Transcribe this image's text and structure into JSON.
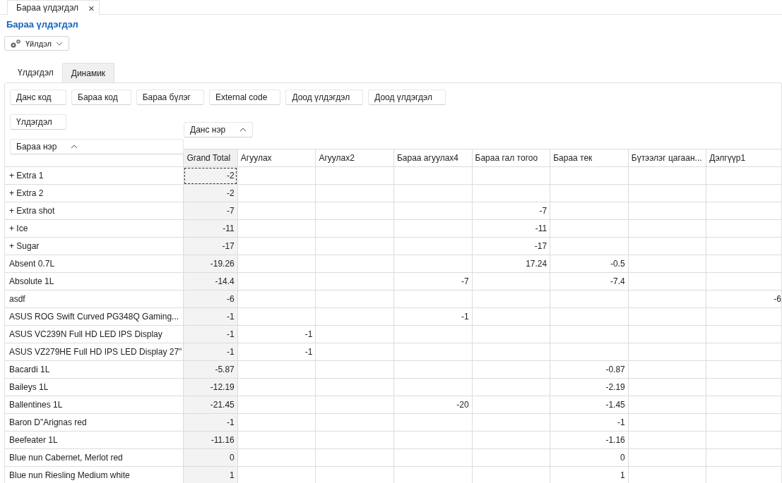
{
  "doc_tabs": [
    {
      "label": "Бараа үлдэгдэл",
      "selected": true,
      "close": "×"
    }
  ],
  "title": "Бараа үлдэгдэл",
  "action_button": {
    "label": "Үйлдэл"
  },
  "tabs": [
    {
      "label": "Үлдэгдэл",
      "selected": false
    },
    {
      "label": "Динамик",
      "selected": true
    }
  ],
  "field_buttons": [
    "Данс код",
    "Бараа код",
    "Бараа бүлэг",
    "External code",
    "Доод үлдэгдэл",
    "Доод үлдэгдэл"
  ],
  "data_fields": [
    "Үлдэгдэл"
  ],
  "column_field": {
    "label": "Данс нэр",
    "sort_ascending": true
  },
  "row_field": {
    "label": "Бараа нэр",
    "sort_ascending": true
  },
  "columns": [
    "Grand Total",
    "Агуулах",
    "Агуулах2",
    "Бараа агуулах4",
    "Бараа гал тогоо",
    "Бараа тек",
    "Бүтээлэг цагаан...",
    "Дэлгүүр1"
  ],
  "rows": [
    {
      "label": "+ Extra 1",
      "focused": true,
      "cells": [
        "-2",
        null,
        null,
        null,
        null,
        null,
        null,
        null
      ]
    },
    {
      "label": "+ Extra 2",
      "focused": false,
      "cells": [
        "-2",
        null,
        null,
        null,
        null,
        null,
        null,
        null
      ]
    },
    {
      "label": "+ Extra shot",
      "focused": false,
      "cells": [
        "-7",
        null,
        null,
        null,
        "-7",
        null,
        null,
        null
      ]
    },
    {
      "label": "+ Ice",
      "focused": false,
      "cells": [
        "-11",
        null,
        null,
        null,
        "-11",
        null,
        null,
        null
      ]
    },
    {
      "label": "+ Sugar",
      "focused": false,
      "cells": [
        "-17",
        null,
        null,
        null,
        "-17",
        null,
        null,
        null
      ]
    },
    {
      "label": "Absent 0.7L",
      "focused": false,
      "cells": [
        "-19.26",
        null,
        null,
        null,
        "17.24",
        "-0.5",
        null,
        null
      ]
    },
    {
      "label": "Absolute 1L",
      "focused": false,
      "cells": [
        "-14.4",
        null,
        null,
        "-7",
        null,
        "-7.4",
        null,
        null
      ]
    },
    {
      "label": "asdf",
      "focused": false,
      "cells": [
        "-6",
        null,
        null,
        null,
        null,
        null,
        null,
        "-6"
      ]
    },
    {
      "label": "ASUS ROG Swift Curved PG348Q Gaming...",
      "focused": false,
      "cells": [
        "-1",
        null,
        null,
        "-1",
        null,
        null,
        null,
        null
      ]
    },
    {
      "label": "ASUS VC239N Full HD LED IPS Display",
      "focused": false,
      "cells": [
        "-1",
        "-1",
        null,
        null,
        null,
        null,
        null,
        null
      ]
    },
    {
      "label": "ASUS VZ279HE Full HD IPS LED Display   27\"",
      "focused": false,
      "cells": [
        "-1",
        "-1",
        null,
        null,
        null,
        null,
        null,
        null
      ]
    },
    {
      "label": "Bacardi 1L",
      "focused": false,
      "cells": [
        "-5.87",
        null,
        null,
        null,
        null,
        "-0.87",
        null,
        null
      ]
    },
    {
      "label": "Baileys 1L",
      "focused": false,
      "cells": [
        "-12.19",
        null,
        null,
        null,
        null,
        "-2.19",
        null,
        null
      ]
    },
    {
      "label": "Ballentines 1L",
      "focused": false,
      "cells": [
        "-21.45",
        null,
        null,
        "-20",
        null,
        "-1.45",
        null,
        null
      ]
    },
    {
      "label": "Baron D\"Arignas red",
      "focused": false,
      "cells": [
        "-1",
        null,
        null,
        null,
        null,
        "-1",
        null,
        null
      ]
    },
    {
      "label": "Beefeater 1L",
      "focused": false,
      "cells": [
        "-11.16",
        null,
        null,
        null,
        null,
        "-1.16",
        null,
        null
      ]
    },
    {
      "label": "Blue nun Cabernet, Merlot red",
      "focused": false,
      "cells": [
        "0",
        null,
        null,
        null,
        null,
        "0",
        null,
        null
      ]
    },
    {
      "label": "Blue nun Riesling Medium white",
      "focused": false,
      "cells": [
        "1",
        null,
        null,
        null,
        null,
        "1",
        null,
        null
      ]
    }
  ]
}
